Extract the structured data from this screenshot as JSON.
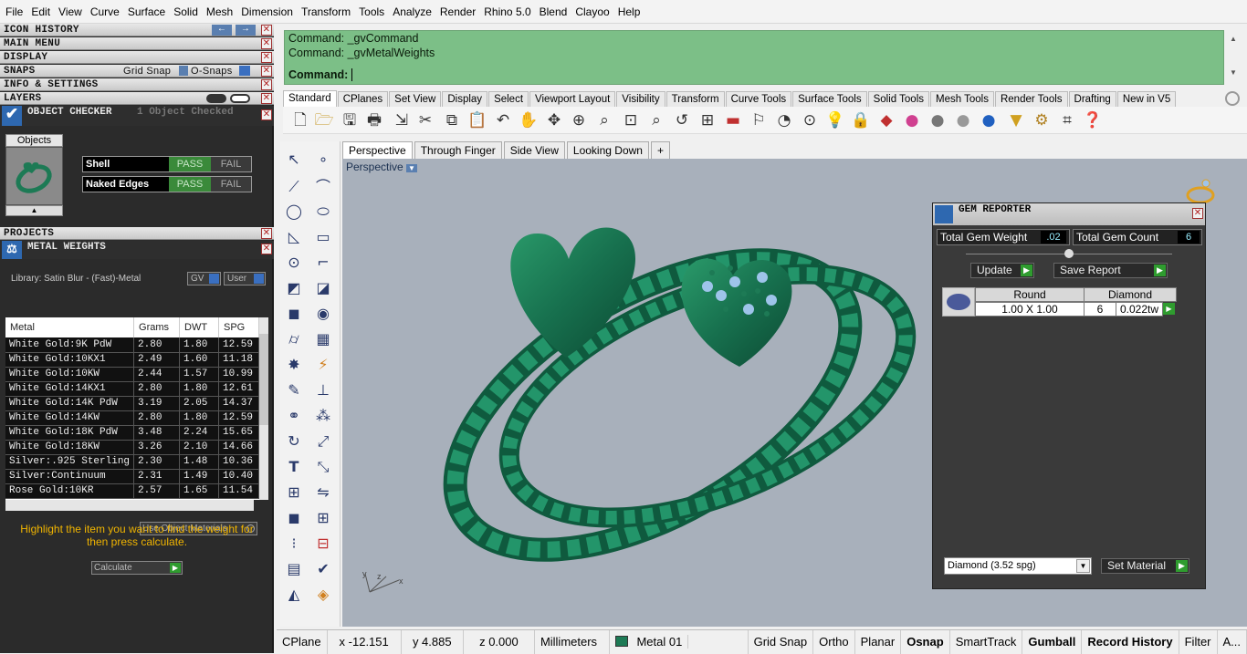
{
  "menu": [
    "File",
    "Edit",
    "View",
    "Curve",
    "Surface",
    "Solid",
    "Mesh",
    "Dimension",
    "Transform",
    "Tools",
    "Analyze",
    "Render",
    "Rhino 5.0",
    "Blend",
    "Clayoo",
    "Help"
  ],
  "left": {
    "sections": {
      "icon_history": "ICON HISTORY",
      "main_menu": "MAIN MENU",
      "display": "DISPLAY",
      "snaps": "SNAPS",
      "grid_snap": "Grid Snap",
      "osnaps": "O-Snaps",
      "info": "INFO & SETTINGS",
      "layers": "LAYERS",
      "object_checker": "OBJECT CHECKER",
      "object_checked": "1  Object Checked",
      "objects_tab": "Objects",
      "projects": "PROJECTS",
      "metal_weights": "METAL WEIGHTS"
    },
    "checks": [
      {
        "name": "Shell",
        "pass": "PASS",
        "fail": "FAIL"
      },
      {
        "name": "Naked Edges",
        "pass": "PASS",
        "fail": "FAIL"
      }
    ],
    "library": "Library: Satin Blur - (Fast)-Metal",
    "gv": "GV",
    "user": "User",
    "table": {
      "headers": [
        "Metal",
        "Grams",
        "DWT",
        "SPG"
      ],
      "rows": [
        [
          "White Gold:9K PdW",
          "2.80",
          "1.80",
          "12.59"
        ],
        [
          "White Gold:10KX1",
          "2.49",
          "1.60",
          "11.18"
        ],
        [
          "White Gold:10KW",
          "2.44",
          "1.57",
          "10.99"
        ],
        [
          "White Gold:14KX1",
          "2.80",
          "1.80",
          "12.61"
        ],
        [
          "White Gold:14K PdW",
          "3.19",
          "2.05",
          "14.37"
        ],
        [
          "White Gold:14KW",
          "2.80",
          "1.80",
          "12.59"
        ],
        [
          "White Gold:18K PdW",
          "3.48",
          "2.24",
          "15.65"
        ],
        [
          "White Gold:18KW",
          "3.26",
          "2.10",
          "14.66"
        ],
        [
          "Silver:.925 Sterling",
          "2.30",
          "1.48",
          "10.36"
        ],
        [
          "Silver:Continuum",
          "2.31",
          "1.49",
          "10.40"
        ],
        [
          "Rose Gold:10KR",
          "2.57",
          "1.65",
          "11.54"
        ]
      ]
    },
    "use_object_materials": "Use Object Materials",
    "hint": "Highlight the item you want to find the weight for then press calculate.",
    "calculate": "Calculate"
  },
  "command": {
    "lines": [
      "Command: _gvCommand",
      "Command: _gvMetalWeights"
    ],
    "prompt": "Command:"
  },
  "tabs": [
    "Standard",
    "CPlanes",
    "Set View",
    "Display",
    "Select",
    "Viewport Layout",
    "Visibility",
    "Transform",
    "Curve Tools",
    "Surface Tools",
    "Solid Tools",
    "Mesh Tools",
    "Render Tools",
    "Drafting",
    "New in V5"
  ],
  "view_tabs": [
    "Perspective",
    "Through Finger",
    "Side View",
    "Looking Down"
  ],
  "viewport_label": "Perspective",
  "gem": {
    "title": "GEM REPORTER",
    "total_weight_label": "Total Gem Weight",
    "total_weight": ".02",
    "total_count_label": "Total Gem Count",
    "total_count": "6",
    "update": "Update",
    "save_report": "Save Report",
    "cols": [
      "Round",
      "Diamond"
    ],
    "row": {
      "size": "1.00 X 1.00",
      "count": "6",
      "weight": "0.022tw"
    },
    "material": "Diamond    (3.52 spg)",
    "set_material": "Set Material"
  },
  "status": {
    "cplane": "CPlane",
    "x": "x -12.151",
    "y": "y 4.885",
    "z": "z 0.000",
    "units": "Millimeters",
    "layer": "Metal 01",
    "toggles": [
      "Grid Snap",
      "Ortho",
      "Planar",
      "Osnap",
      "SmartTrack",
      "Gumball",
      "Record History",
      "Filter",
      "A..."
    ]
  },
  "colors": {
    "metal": "#1d7a55",
    "command_bg": "#7cbf87",
    "viewport_bg": "#a8b0bb"
  }
}
